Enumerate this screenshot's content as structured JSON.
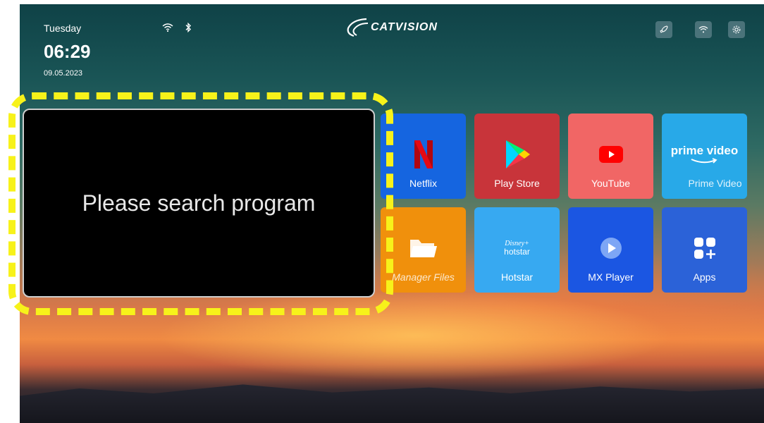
{
  "status": {
    "day": "Tuesday",
    "time": "06:29",
    "date": "09.05.2023",
    "wifi_icon": "wifi-icon",
    "bluetooth_icon": "bluetooth-icon"
  },
  "brand": {
    "logo_text": "CATVISION"
  },
  "top_buttons": [
    "launch-icon",
    "wifi-icon",
    "settings-icon"
  ],
  "preview": {
    "message": "Please search program"
  },
  "apps": [
    {
      "label": "Netflix",
      "color": "#1565e0"
    },
    {
      "label": "Play Store",
      "color": "#c8343a"
    },
    {
      "label": "YouTube",
      "color": "#f16665"
    },
    {
      "label": "Prime Video",
      "color": "#28a9e8",
      "icon_text": "prime video"
    },
    {
      "label": "Manager",
      "color": "#f0900c"
    },
    {
      "label": "Files",
      "color": "#f0900c"
    },
    {
      "label": "Hotstar",
      "color": "#37a9f1",
      "icon_text_1": "Disney+",
      "icon_text_2": "hotstar"
    },
    {
      "label": "MX Player",
      "color": "#1b56e2"
    },
    {
      "label": "Apps",
      "color": "#2b62d8"
    }
  ]
}
